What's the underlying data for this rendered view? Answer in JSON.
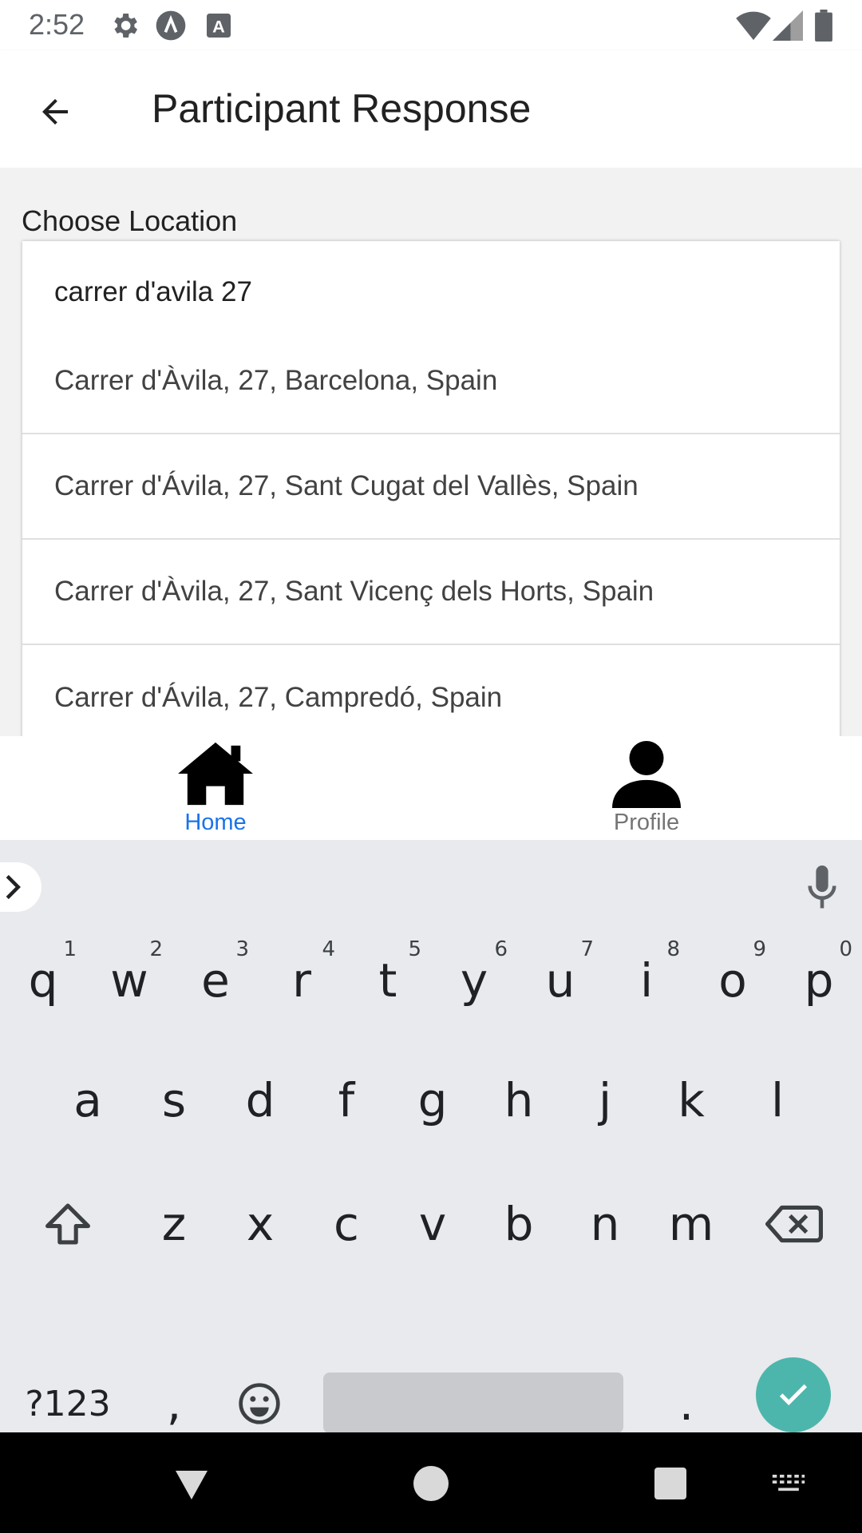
{
  "status_bar": {
    "time": "2:52",
    "icons_left": [
      "settings-icon",
      "accessibility-icon",
      "text-a-icon"
    ],
    "icons_right": [
      "wifi-icon",
      "signal-icon",
      "battery-icon"
    ]
  },
  "app_bar": {
    "title": "Participant Response",
    "back_icon": "arrow-back-icon"
  },
  "form": {
    "label": "Choose Location",
    "search_value": "carrer d'avila 27",
    "suggestions": [
      "Carrer d'Àvila, 27, Barcelona, Spain",
      "Carrer d'Ávila, 27, Sant Cugat del Vallès, Spain",
      "Carrer d'Àvila, 27, Sant Vicenç dels Horts, Spain",
      "Carrer d'Ávila, 27, Campredó, Spain"
    ]
  },
  "bottom_nav": {
    "items": [
      {
        "label": "Home",
        "icon": "home-icon",
        "active": true
      },
      {
        "label": "Profile",
        "icon": "person-icon",
        "active": false
      }
    ],
    "active_color": "#1a73e8",
    "inactive_color": "#757575"
  },
  "keyboard": {
    "row1": [
      {
        "key": "q",
        "hint": "1"
      },
      {
        "key": "w",
        "hint": "2"
      },
      {
        "key": "e",
        "hint": "3"
      },
      {
        "key": "r",
        "hint": "4"
      },
      {
        "key": "t",
        "hint": "5"
      },
      {
        "key": "y",
        "hint": "6"
      },
      {
        "key": "u",
        "hint": "7"
      },
      {
        "key": "i",
        "hint": "8"
      },
      {
        "key": "o",
        "hint": "9"
      },
      {
        "key": "p",
        "hint": "0"
      }
    ],
    "row2": [
      "a",
      "s",
      "d",
      "f",
      "g",
      "h",
      "j",
      "k",
      "l"
    ],
    "row3": [
      "z",
      "x",
      "c",
      "v",
      "b",
      "n",
      "m"
    ],
    "symbols_label": "?123",
    "comma": ",",
    "period": ".",
    "enter_color": "#4db6ac"
  },
  "system_nav": {
    "buttons": [
      "back-triangle-icon",
      "home-circle-icon",
      "recents-square-icon",
      "keyboard-switch-icon"
    ]
  }
}
